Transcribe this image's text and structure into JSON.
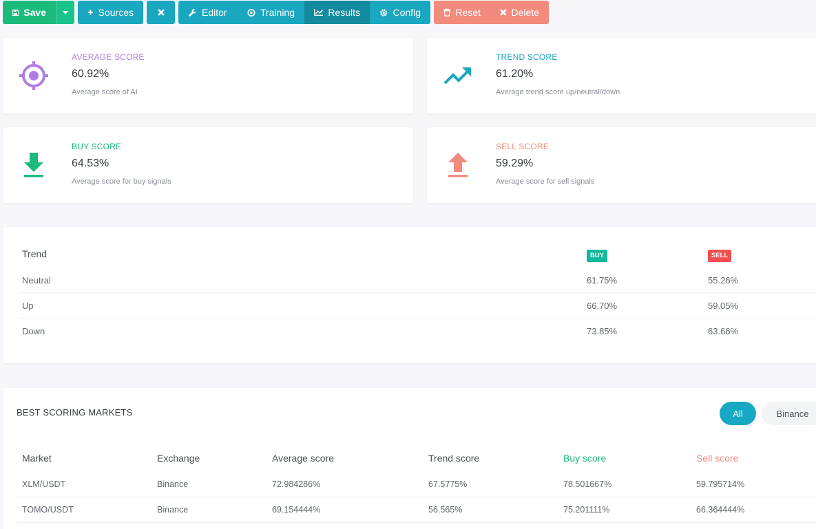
{
  "toolbar": {
    "save": "Save",
    "sources": "Sources",
    "editor": "Editor",
    "training": "Training",
    "results": "Results",
    "config": "Config",
    "reset": "Reset",
    "delete": "Delete"
  },
  "stats": {
    "average": {
      "label": "AVERAGE SCORE",
      "value": "60.92%",
      "desc": "Average score of AI",
      "color": "#b27ce6"
    },
    "trend": {
      "label": "TREND SCORE",
      "value": "61.20%",
      "desc": "Average trend score up/neutral/down",
      "color": "#1aa7c0"
    },
    "buy": {
      "label": "BUY SCORE",
      "value": "64.53%",
      "desc": "Average score for buy signals",
      "color": "#1bbb7c"
    },
    "sell": {
      "label": "SELL SCORE",
      "value": "59.29%",
      "desc": "Average score for sell signals",
      "color": "#f28a7d"
    }
  },
  "trend_table": {
    "header": {
      "trend": "Trend",
      "buy": "BUY",
      "sell": "SELL"
    },
    "rows": [
      {
        "trend": "Neutral",
        "buy": "61.75%",
        "sell": "55.26%"
      },
      {
        "trend": "Up",
        "buy": "66.70%",
        "sell": "59.05%"
      },
      {
        "trend": "Down",
        "buy": "73.85%",
        "sell": "63.66%"
      }
    ]
  },
  "markets": {
    "title": "BEST SCORING MARKETS",
    "filters": [
      "All",
      "Binance"
    ],
    "headers": {
      "market": "Market",
      "exchange": "Exchange",
      "average": "Average score",
      "trend": "Trend score",
      "buy": "Buy score",
      "sell": "Sell score"
    },
    "rows": [
      {
        "market": "XLM/USDT",
        "exchange": "Binance",
        "average": "72.984286%",
        "trend": "67.5775%",
        "buy": "78.501667%",
        "sell": "59.795714%"
      },
      {
        "market": "TOMO/USDT",
        "exchange": "Binance",
        "average": "69.154444%",
        "trend": "56.565%",
        "buy": "75.201111%",
        "sell": "66.364444%"
      }
    ]
  },
  "colors": {
    "buy_badge": "#12b89b",
    "sell_badge": "#ef4f4f",
    "buy_header": "#1bbb7c",
    "sell_header": "#f28a7d"
  }
}
